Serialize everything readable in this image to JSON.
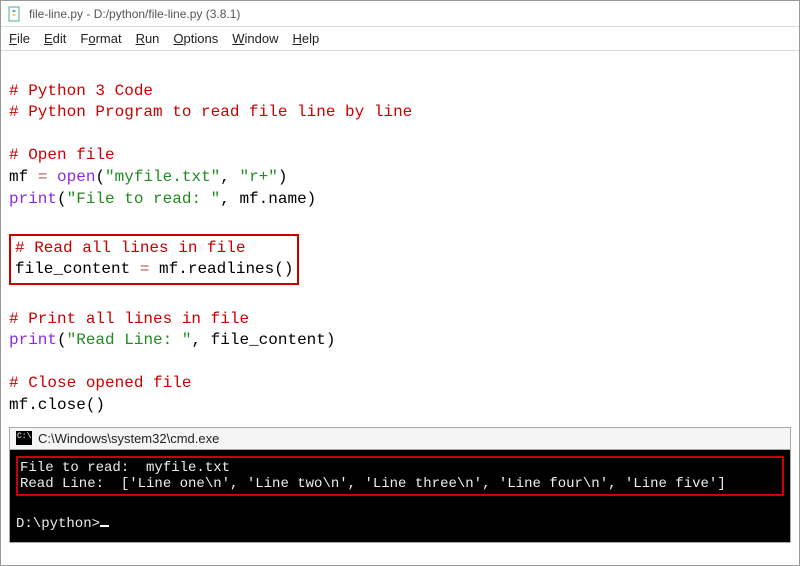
{
  "window": {
    "title": "file-line.py - D:/python/file-line.py (3.8.1)"
  },
  "menu": {
    "file": {
      "label": "File",
      "u": "F",
      "rest": "ile"
    },
    "edit": {
      "label": "Edit",
      "u": "E",
      "rest": "dit"
    },
    "format": {
      "label": "Format",
      "u": "o",
      "pre": "F",
      "rest": "rmat"
    },
    "run": {
      "label": "Run",
      "u": "R",
      "rest": "un"
    },
    "options": {
      "label": "Options",
      "u": "O",
      "rest": "ptions"
    },
    "window": {
      "label": "Window",
      "u": "W",
      "rest": "indow"
    },
    "help": {
      "label": "Help",
      "u": "H",
      "rest": "elp"
    }
  },
  "code": {
    "l1": "# Python 3 Code",
    "l2": "# Python Program to read file line by line",
    "l4": "# Open file",
    "l5_var": "mf ",
    "l5_eq": "=",
    "l5_open": " open",
    "l5_par_o": "(",
    "l5_str1": "\"myfile.txt\"",
    "l5_comma": ", ",
    "l5_str2": "\"r+\"",
    "l5_par_c": ")",
    "l6_print": "print",
    "l6_par_o": "(",
    "l6_str": "\"File to read: \"",
    "l6_rest": ", mf.name)",
    "l8": "# Read all lines in file",
    "l9_lhs": "file_content ",
    "l9_eq": "=",
    "l9_rhs": " mf.readlines()",
    "l11": "# Print all lines in file",
    "l12_print": "print",
    "l12_par_o": "(",
    "l12_str": "\"Read Line: \"",
    "l12_rest": ", file_content)",
    "l14": "# Close opened file",
    "l15": "mf.close()"
  },
  "console": {
    "title": "C:\\Windows\\system32\\cmd.exe",
    "out1": "File to read:  myfile.txt",
    "out2": "Read Line:  ['Line one\\n', 'Line two\\n', 'Line three\\n', 'Line four\\n', 'Line five']",
    "prompt": "D:\\python>"
  }
}
